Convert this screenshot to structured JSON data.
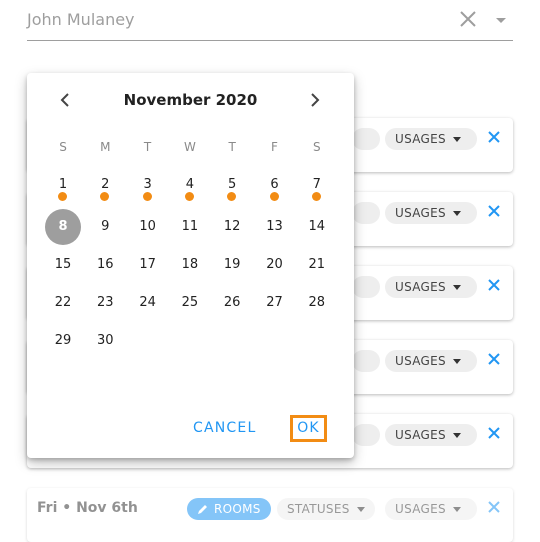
{
  "field": {
    "value": "John Mulaney",
    "clear_icon": "close-icon",
    "dropdown_icon": "caret-down-icon"
  },
  "cards": [
    {
      "date": "",
      "usages": "USAGES"
    },
    {
      "date": "",
      "usages": "USAGES"
    },
    {
      "date": "",
      "usages": "USAGES"
    },
    {
      "date": "",
      "usages": "USAGES"
    },
    {
      "date": "",
      "usages": "USAGES"
    },
    {
      "date": "Fri • Nov 6th",
      "rooms": "ROOMS",
      "statuses": "STATUSES",
      "usages": "USAGES"
    }
  ],
  "picker": {
    "month_title": "November 2020",
    "weekdays": [
      "S",
      "M",
      "T",
      "W",
      "T",
      "F",
      "S"
    ],
    "days": [
      "1",
      "2",
      "3",
      "4",
      "5",
      "6",
      "7",
      "8",
      "9",
      "10",
      "11",
      "12",
      "13",
      "14",
      "15",
      "16",
      "17",
      "18",
      "19",
      "20",
      "21",
      "22",
      "23",
      "24",
      "25",
      "26",
      "27",
      "28",
      "29",
      "30"
    ],
    "event_days": [
      "1",
      "2",
      "3",
      "4",
      "5",
      "6",
      "7"
    ],
    "selected_day": "8",
    "cancel_label": "CANCEL",
    "ok_label": "OK"
  },
  "colors": {
    "accent": "#2196f3",
    "event_dot": "#f28c14",
    "selected": "#9e9e9e"
  }
}
